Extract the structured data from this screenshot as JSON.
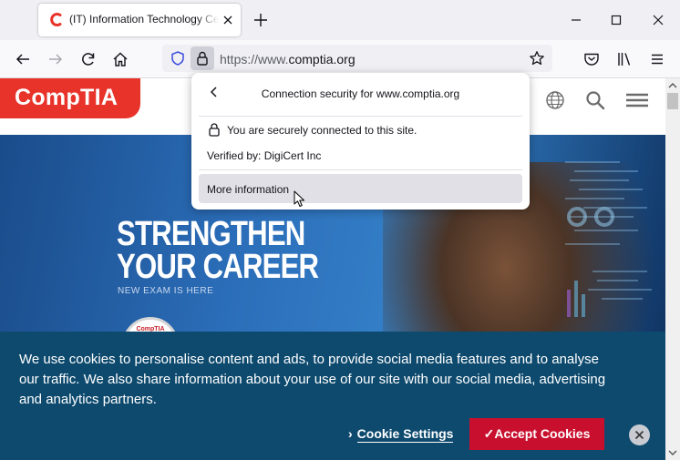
{
  "tab": {
    "title": "(IT) Information Technology Certifications | CompTIA",
    "favicon_color": "#e8332a"
  },
  "url": {
    "scheme_prefix": "https://www.",
    "host": "comptia.org"
  },
  "site": {
    "logo_text": "CompTIA",
    "brand_color": "#e8332a"
  },
  "hero": {
    "headline_line1": "STRENGTHEN",
    "headline_line2": "YOUR CAREER",
    "subtext": "NEW EXAM IS HERE",
    "badge_text": "CompTIA"
  },
  "identity_popup": {
    "title": "Connection security for www.comptia.org",
    "secure_message": "You are securely connected to this site.",
    "verified_by": "Verified by: DigiCert Inc",
    "more_information": "More information"
  },
  "cookie_banner": {
    "text": "We use cookies to personalise content and ads, to provide social media features and to analyse our traffic. We also share information about your use of our site with our social media, advertising and analytics partners.",
    "settings_chevron": "›",
    "settings_label": "Cookie Settings",
    "accept_label": "✓Accept Cookies",
    "background_color": "#0e4a6e",
    "accept_color": "#c8102e"
  },
  "icons": {
    "tab_close": "close-icon",
    "new_tab": "plus-icon",
    "back": "back-arrow-icon",
    "forward": "forward-arrow-icon",
    "reload": "reload-icon",
    "home": "home-icon",
    "tracking_protection": "shield-icon",
    "lock": "lock-icon",
    "bookmark": "star-icon",
    "pocket": "pocket-icon",
    "library": "library-icon",
    "menu": "hamburger-menu-icon"
  }
}
